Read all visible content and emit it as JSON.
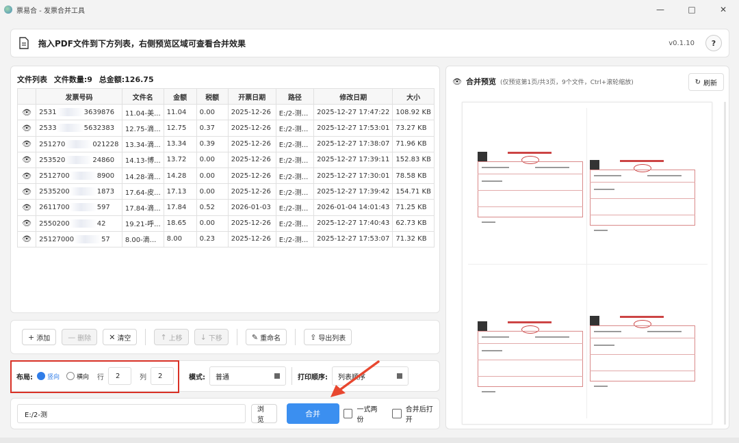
{
  "window": {
    "title": "票易合 - 发票合并工具",
    "controls": [
      "minimize",
      "maximize",
      "close"
    ]
  },
  "header": {
    "instruction": "拖入PDF文件到下方列表，右侧预览区域可查看合并效果",
    "version": "v0.1.10",
    "help_label": "?"
  },
  "file_list": {
    "title": "文件列表",
    "count_label": "文件数量:9",
    "total_label": "总金额:126.75",
    "columns": [
      "",
      "发票号码",
      "文件名",
      "金额",
      "税额",
      "开票日期",
      "路径",
      "修改日期",
      "大小"
    ],
    "rows": [
      {
        "num_a": "2531",
        "num_b": "3639876",
        "file": "11.04-美...",
        "amount": "11.04",
        "tax": "0.00",
        "date": "2025-12-26",
        "path": "E:/2-测...",
        "mtime": "2025-12-27 17:47:22",
        "size": "108.92 KB"
      },
      {
        "num_a": "2533",
        "num_b": "5632383",
        "file": "12.75-滴...",
        "amount": "12.75",
        "tax": "0.37",
        "date": "2025-12-26",
        "path": "E:/2-测...",
        "mtime": "2025-12-27 17:53:01",
        "size": "73.27 KB"
      },
      {
        "num_a": "251270",
        "num_b": "021228",
        "file": "13.34-滴...",
        "amount": "13.34",
        "tax": "0.39",
        "date": "2025-12-26",
        "path": "E:/2-测...",
        "mtime": "2025-12-27 17:38:07",
        "size": "71.96 KB"
      },
      {
        "num_a": "253520",
        "num_b": "24860",
        "file": "14.13-博...",
        "amount": "13.72",
        "tax": "0.00",
        "date": "2025-12-26",
        "path": "E:/2-测...",
        "mtime": "2025-12-27 17:39:11",
        "size": "152.83 KB"
      },
      {
        "num_a": "2512700",
        "num_b": "8900",
        "file": "14.28-滴...",
        "amount": "14.28",
        "tax": "0.00",
        "date": "2025-12-26",
        "path": "E:/2-测...",
        "mtime": "2025-12-27 17:30:01",
        "size": "78.58 KB"
      },
      {
        "num_a": "2535200",
        "num_b": "1873",
        "file": "17.64-皮...",
        "amount": "17.13",
        "tax": "0.00",
        "date": "2025-12-26",
        "path": "E:/2-测...",
        "mtime": "2025-12-27 17:39:42",
        "size": "154.71 KB"
      },
      {
        "num_a": "2611700",
        "num_b": "597",
        "file": "17.84-滴...",
        "amount": "17.84",
        "tax": "0.52",
        "date": "2026-01-03",
        "path": "E:/2-测...",
        "mtime": "2026-01-04 14:01:43",
        "size": "71.25 KB"
      },
      {
        "num_a": "2550200",
        "num_b": "42",
        "file": "19.21-呼...",
        "amount": "18.65",
        "tax": "0.00",
        "date": "2025-12-26",
        "path": "E:/2-测...",
        "mtime": "2025-12-27 17:40:43",
        "size": "62.73 KB"
      },
      {
        "num_a": "25127000",
        "num_b": "57",
        "file": "8.00-滴...",
        "amount": "8.00",
        "tax": "0.23",
        "date": "2025-12-26",
        "path": "E:/2-测...",
        "mtime": "2025-12-27 17:53:07",
        "size": "71.32 KB"
      }
    ]
  },
  "toolbar": {
    "add": "添加",
    "delete": "删除",
    "clear": "清空",
    "move_up": "上移",
    "move_down": "下移",
    "rename": "重命名",
    "export_list": "导出列表"
  },
  "layout_options": {
    "layout_label": "布局:",
    "portrait": "竖向",
    "landscape": "横向",
    "selected": "竖向",
    "rows_label": "行",
    "rows_value": "2",
    "cols_label": "列",
    "cols_value": "2",
    "mode_label": "模式:",
    "mode_value": "普通",
    "print_order_label": "打印顺序:",
    "print_order_value": "列表顺序"
  },
  "output": {
    "path_value": "E:/2-测",
    "browse": "浏览",
    "merge": "合并",
    "duplicate_copy": "一式两份",
    "open_after_merge": "合并后打开",
    "duplicate_checked": false,
    "open_checked": false
  },
  "preview": {
    "title": "合并预览",
    "subtitle": "(仅预览第1页/共3页，9个文件，Ctrl+滚轮缩放)",
    "refresh": "刷新"
  },
  "colors": {
    "accent": "#3b8ff0",
    "highlight_box": "#d93025",
    "arrow": "#e8472f"
  }
}
